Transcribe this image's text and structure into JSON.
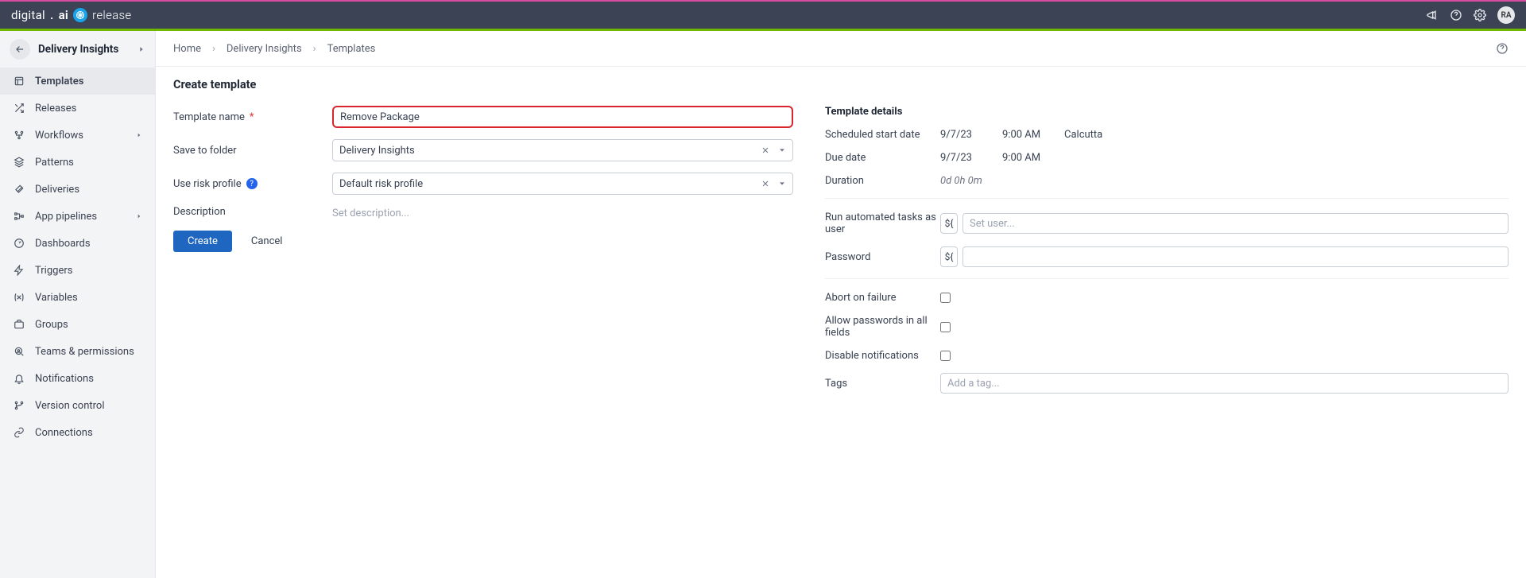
{
  "brand": {
    "name1": "digital",
    "dot": ".",
    "name2": "ai",
    "product": "release"
  },
  "top": {
    "avatar": "RA"
  },
  "sidebar": {
    "title": "Delivery Insights",
    "items": [
      {
        "label": "Templates",
        "icon": "template",
        "active": true
      },
      {
        "label": "Releases",
        "icon": "shuffle"
      },
      {
        "label": "Workflows",
        "icon": "workflow",
        "expand": true
      },
      {
        "label": "Patterns",
        "icon": "layers"
      },
      {
        "label": "Deliveries",
        "icon": "rocket"
      },
      {
        "label": "App pipelines",
        "icon": "pipeline",
        "expand": true
      },
      {
        "label": "Dashboards",
        "icon": "gauge"
      },
      {
        "label": "Triggers",
        "icon": "bolt"
      },
      {
        "label": "Variables",
        "icon": "variable"
      },
      {
        "label": "Groups",
        "icon": "briefcase"
      },
      {
        "label": "Teams & permissions",
        "icon": "search-user"
      },
      {
        "label": "Notifications",
        "icon": "bell"
      },
      {
        "label": "Version control",
        "icon": "branch"
      },
      {
        "label": "Connections",
        "icon": "link"
      }
    ]
  },
  "breadcrumbs": [
    "Home",
    "Delivery Insights",
    "Templates"
  ],
  "page": {
    "title": "Create template",
    "form": {
      "template_name_label": "Template name",
      "template_name_value": "Remove Package",
      "save_to_folder_label": "Save to folder",
      "save_to_folder_value": "Delivery Insights",
      "use_risk_profile_label": "Use risk profile",
      "use_risk_profile_value": "Default risk profile",
      "description_label": "Description",
      "description_placeholder": "Set description...",
      "create_label": "Create",
      "cancel_label": "Cancel"
    },
    "details": {
      "heading": "Template details",
      "start_label": "Scheduled start date",
      "start_date": "9/7/23",
      "start_time": "9:00 AM",
      "start_tz": "Calcutta",
      "due_label": "Due date",
      "due_date": "9/7/23",
      "due_time": "9:00 AM",
      "duration_label": "Duration",
      "duration_value": "0d 0h 0m",
      "run_as_label": "Run automated tasks as user",
      "run_as_placeholder": "Set user...",
      "password_label": "Password",
      "abort_label": "Abort on failure",
      "allow_pwd_label": "Allow passwords in all fields",
      "disable_notif_label": "Disable notifications",
      "tags_label": "Tags",
      "tags_placeholder": "Add a tag...",
      "var_token": "${"
    }
  }
}
